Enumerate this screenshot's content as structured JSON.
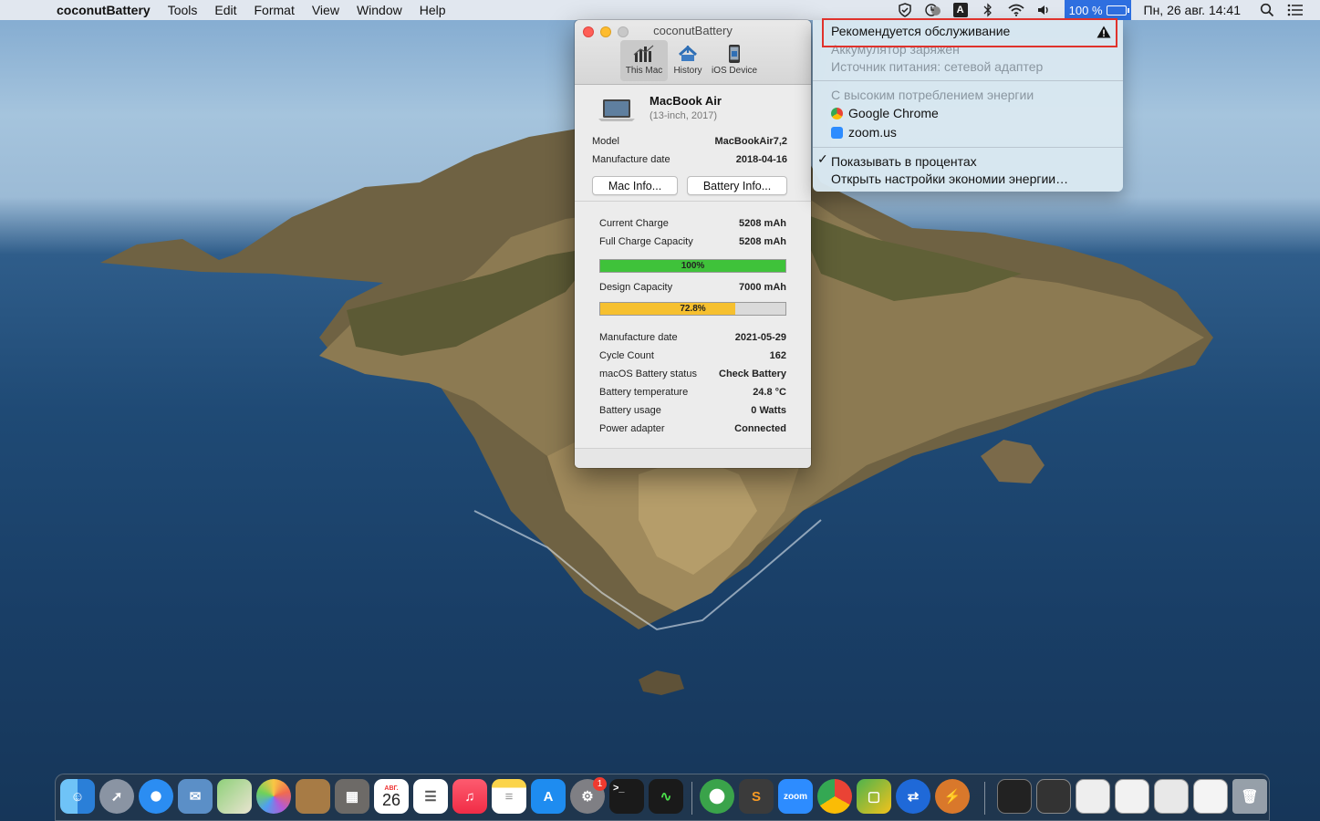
{
  "menubar": {
    "app_name": "coconutBattery",
    "menus": [
      "Tools",
      "Edit",
      "Format",
      "View",
      "Window",
      "Help"
    ],
    "status_icons": [
      "shield-icon",
      "clock-icon",
      "input-source-icon",
      "bluetooth-icon",
      "wifi-icon",
      "volume-icon"
    ],
    "input_source_label": "A",
    "battery_percent": "100 %",
    "datetime": "Пн, 26 авг.  14:41"
  },
  "window": {
    "title": "coconutBattery",
    "tabs": [
      {
        "label": "This Mac",
        "icon": "chart-icon",
        "active": true
      },
      {
        "label": "History",
        "icon": "history-icon",
        "active": false
      },
      {
        "label": "iOS Device",
        "icon": "phone-icon",
        "active": false
      }
    ],
    "mac": {
      "name": "MacBook Air",
      "subtitle": "(13-inch, 2017)",
      "model_label": "Model",
      "model_value": "MacBookAir7,2",
      "manufacture_label": "Manufacture date",
      "manufacture_value": "2018-04-16",
      "mac_info_button": "Mac Info...",
      "battery_info_button": "Battery Info..."
    },
    "battery": {
      "current_charge_label": "Current Charge",
      "current_charge_value": "5208 mAh",
      "full_charge_label": "Full Charge Capacity",
      "full_charge_value": "5208 mAh",
      "charge_bar_label": "100%",
      "charge_fraction": 1.0,
      "charge_color": "#3fc23a",
      "design_capacity_label": "Design Capacity",
      "design_capacity_value": "7000 mAh",
      "capacity_bar_label": "72.8%",
      "capacity_fraction": 0.728,
      "capacity_color": "#f6c02f",
      "details": [
        {
          "label": "Manufacture date",
          "value": "2021-05-29"
        },
        {
          "label": "Cycle Count",
          "value": "162"
        },
        {
          "label": "macOS Battery status",
          "value": "Check Battery"
        },
        {
          "label": "Battery temperature",
          "value": "24.8 °C"
        },
        {
          "label": "Battery usage",
          "value": "0 Watts"
        },
        {
          "label": "Power adapter",
          "value": "Connected"
        }
      ]
    }
  },
  "battery_menu": {
    "service_recommended": "Рекомендуется обслуживание",
    "battery_charged": "Аккумулятор заряжен",
    "power_source": "Источник питания: сетевой адаптер",
    "high_energy_header": "С высоким потреблением энергии",
    "apps": [
      {
        "name": "Google Chrome",
        "icon": "chrome-icon"
      },
      {
        "name": "zoom.us",
        "icon": "zoom-icon"
      }
    ],
    "show_percent": "Показывать в процентах",
    "show_percent_checked": true,
    "open_settings": "Открыть настройки экономии энергии…"
  },
  "dock": {
    "apps": [
      "finder-icon",
      "launchpad-icon",
      "safari-icon",
      "mail-icon",
      "maps-icon",
      "photos-icon",
      "contacts-icon",
      "calculator-icon",
      "calendar-icon",
      "reminders-icon",
      "music-icon",
      "notes-icon",
      "app-store-icon",
      "system-preferences-icon",
      "terminal-icon",
      "activity-monitor-icon",
      "vpn-icon",
      "sublime-icon",
      "zoom-icon",
      "chrome-icon",
      "messages-icon",
      "teamviewer-icon",
      "spark-icon"
    ],
    "calendar_month": "АВГ.",
    "calendar_day": "26",
    "zoom_label": "zoom",
    "settings_badge": "1",
    "recent_windows": [
      "window-thumb-1",
      "window-thumb-2",
      "window-thumb-3",
      "window-thumb-4",
      "window-thumb-5",
      "window-thumb-6"
    ],
    "trash": "trash-icon"
  }
}
